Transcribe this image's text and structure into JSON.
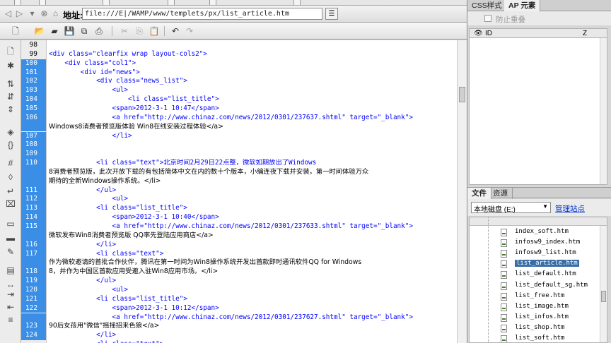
{
  "address": {
    "label": "地址:",
    "url": "file:///E|/WAMP/www/templets/px/list_article.htm"
  },
  "editor": {
    "line_numbers": [
      "98",
      "99",
      "100",
      "101",
      "102",
      "103",
      "104",
      "105",
      "106",
      "",
      "107",
      "108",
      "109",
      "110",
      "",
      "",
      "111",
      "112",
      "113",
      "114",
      "115",
      "",
      "116",
      "117",
      "",
      "118",
      "119",
      "120",
      "121",
      "122",
      "",
      "123",
      "124"
    ],
    "selected_lines": [
      2,
      3,
      4,
      5,
      6,
      7,
      8,
      9,
      10,
      11,
      12,
      13,
      14,
      15,
      16,
      17,
      18,
      19,
      20,
      21,
      22,
      23,
      24,
      25,
      26,
      27,
      28,
      29,
      30,
      31,
      32
    ],
    "code_lines": [
      "",
      "<div class=\"clearfix wrap layout-cols2\">",
      "    <div class=\"col1\">",
      "        <div id=\"news\">",
      "            <div class=\"news_list\">",
      "                <ul>",
      "                    <li class=\"list_title\">",
      "                <span>2012-3-1 10:47</span>",
      "                <a href=\"http://www.chinaz.com/news/2012/0301/237637.shtml\" target=\"_blank\">",
      "Windows8消费者预览版体验 Win8在线安装过程体验</a>",
      "                </li>",
      "",
      "",
      "            <li class=\"text\">北京时间2月29日22点整，微软如期放出了Windows",
      "8消费者预览版，此次开放下载的有包括简体中文在内的数十个版本，小编连夜下载并安装，第一时间体验万众",
      "期待的全新Windows操作系统。</li>",
      "            </ul>",
      "                <ul>",
      "            <li class=\"list_title\">",
      "                <span>2012-3-1 10:40</span>",
      "                <a href=\"http://www.chinaz.com/news/2012/0301/237633.shtml\" target=\"_blank\">",
      "微软发布Win8消费者预览版 QQ率先登陆应用商店</a>",
      "            </li>",
      "            <li class=\"text\">",
      "作为微软邀请的首批合作伙伴，腾讯在第一时间为Win8操作系统开发出首款即时通讯软件QQ for Windows",
      "8，并作为中国区首款应用受邀入驻Win8应用市场。</li>",
      "            </ul>",
      "                <ul>",
      "            <li class=\"list_title\">",
      "                <span>2012-3-1 10:12</span>",
      "                <a href=\"http://www.chinaz.com/news/2012/0301/237627.shtml\" target=\"_blank\">",
      "90后女孩用\"微信\"摇摇招来色狼</a>",
      "            </li>",
      "            <li class=\"text\">"
    ]
  },
  "ap_panel": {
    "tab_css": "CSS样式",
    "tab_ap": "AP 元素",
    "prevent_overlap": "防止重叠",
    "col_id": "ID",
    "col_z": "Z"
  },
  "files_panel": {
    "tab_files": "文件",
    "tab_assets": "资源",
    "site": "本地磁盘 (E:)",
    "manage": "管理站点",
    "files": [
      "index_soft.htm",
      "infosw9_index.htm",
      "infosw9_list.htm",
      "list_article.htm",
      "list_default.htm",
      "list_default_sg.htm",
      "list_free.htm",
      "list_image.htm",
      "list_infos.htm",
      "list_shop.htm",
      "list_soft.htm"
    ],
    "selected_index": 3
  }
}
